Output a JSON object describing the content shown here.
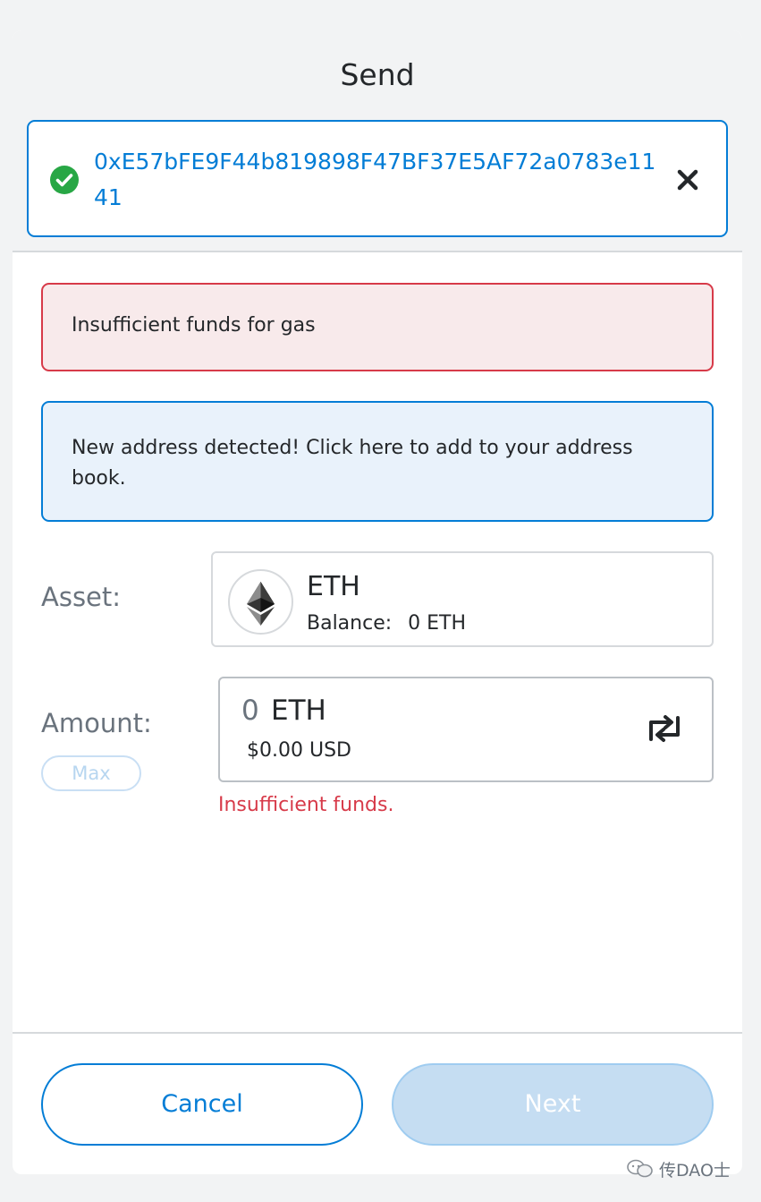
{
  "header": {
    "title": "Send"
  },
  "recipient": {
    "address": "0xE57bFE9F44b819898F47BF37E5AF72a0783e1141",
    "status_icon": "check-circle-icon",
    "clear_icon": "close-icon"
  },
  "alerts": {
    "gas_error": "Insufficient funds for gas",
    "new_address": "New address detected! Click here to add to your address book."
  },
  "asset": {
    "label": "Asset:",
    "symbol": "ETH",
    "balance_label": "Balance:",
    "balance_value": "0 ETH",
    "logo_icon": "ethereum-icon"
  },
  "amount": {
    "label": "Amount:",
    "value": "0",
    "unit": "ETH",
    "fiat": "$0.00 USD",
    "max_label": "Max",
    "swap_icon": "swap-icon",
    "error": "Insufficient funds."
  },
  "footer": {
    "cancel_label": "Cancel",
    "next_label": "Next"
  },
  "watermark": {
    "text": "传DAO士"
  },
  "colors": {
    "accent": "#037dd6",
    "error": "#d73a49",
    "success": "#28a745",
    "error_bg": "#f8eaeb",
    "info_bg": "#e9f2fb"
  }
}
